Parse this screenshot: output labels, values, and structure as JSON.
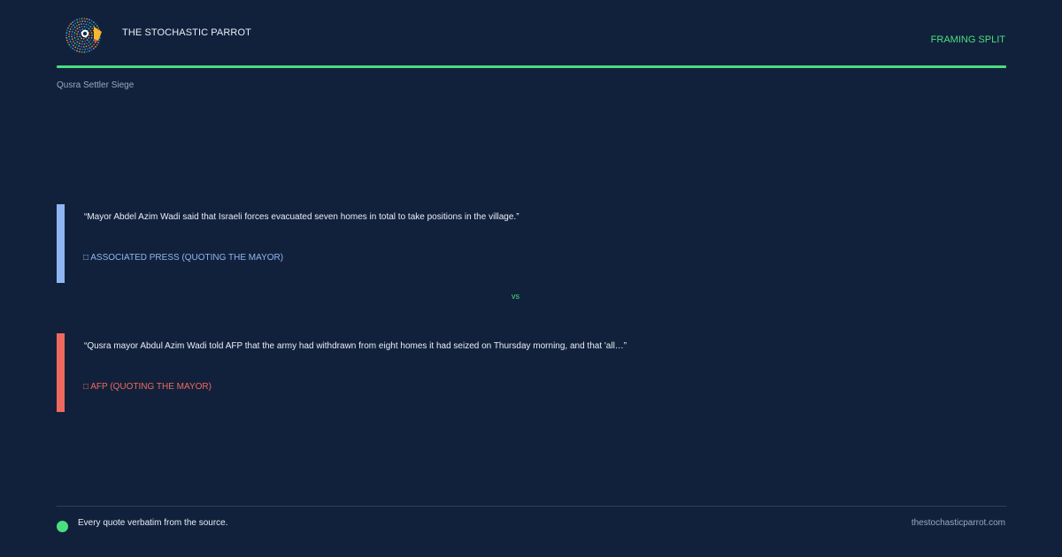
{
  "header": {
    "logo_icon": "parrot-logo-icon",
    "brand": "THE STOCHASTIC PARROT",
    "tag": "FRAMING SPLIT"
  },
  "topic": "Qusra Settler Siege",
  "quotes": [
    {
      "text": "“Mayor Abdel Azim Wadi said that Israeli forces evacuated seven homes in total to take positions in the village.”",
      "source": "□ ASSOCIATED PRESS (QUOTING THE MAYOR)",
      "color": "#8fb6f3"
    },
    {
      "text": "“Qusra mayor Abdul Azim Wadi told AFP that the army had withdrawn from eight homes it had seized on Thursday morning, and that 'all…”",
      "source": "□ AFP (QUOTING THE MAYOR)",
      "color": "#f0695f"
    }
  ],
  "vs": "vs",
  "footer": {
    "note": "Every quote verbatim from the source.",
    "site": "thestochasticparrot.com"
  },
  "colors": {
    "background": "#12213b",
    "accent": "#4ade80",
    "ap": "#8fb6f3",
    "afp": "#f0695f"
  }
}
